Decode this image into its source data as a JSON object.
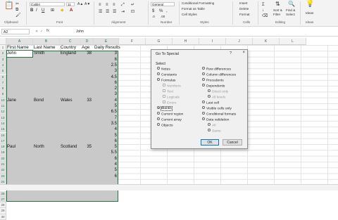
{
  "ribbon": {
    "font_name": "Calibri",
    "font_size": "11",
    "groups": [
      "Clipboard",
      "Font",
      "Alignment",
      "Number",
      "Styles",
      "Cells",
      "Editing",
      "Ideas"
    ],
    "number_format": "General",
    "styles_items": [
      "Conditional Formatting",
      "Format as Table",
      "Cell Styles"
    ],
    "cells_items": [
      "Insert",
      "Delete",
      "Format"
    ],
    "editing_items": [
      "Sort &",
      "Filter",
      "Find &",
      "Select"
    ],
    "ideas_label": "Ideas"
  },
  "formula_bar": {
    "name_box": "A2",
    "fx": "fx",
    "value": "John"
  },
  "columns": [
    "A",
    "B",
    "C",
    "D",
    "E",
    "F",
    "G",
    "H",
    "I",
    "J",
    "K",
    "L"
  ],
  "rows": [
    "1",
    "2",
    "3",
    "4",
    "5",
    "6",
    "7",
    "8",
    "9",
    "10",
    "11",
    "12",
    "13",
    "14",
    "15",
    "16",
    "17",
    "18",
    "19",
    "20",
    "21",
    "22",
    "23",
    "24",
    "25",
    "26",
    "27",
    "28",
    "29",
    "30"
  ],
  "table": {
    "headers": [
      "First Name",
      "Last Name",
      "Country",
      "Age",
      "Daily Results"
    ],
    "cells": [
      {
        "row": 2,
        "col": 0,
        "text": "John"
      },
      {
        "row": 2,
        "col": 1,
        "text": "Smith"
      },
      {
        "row": 2,
        "col": 2,
        "text": "England"
      },
      {
        "row": 2,
        "col": 3,
        "text": "38"
      },
      {
        "row": 2,
        "col": 4,
        "text": "3"
      },
      {
        "row": 3,
        "col": 4,
        "text": "6"
      },
      {
        "row": 4,
        "col": 4,
        "text": "2.5"
      },
      {
        "row": 5,
        "col": 4,
        "text": "3"
      },
      {
        "row": 6,
        "col": 4,
        "text": "4.5"
      },
      {
        "row": 7,
        "col": 4,
        "text": "6"
      },
      {
        "row": 8,
        "col": 4,
        "text": "2"
      },
      {
        "row": 9,
        "col": 4,
        "text": "3"
      },
      {
        "row": 10,
        "col": 0,
        "text": "Jane"
      },
      {
        "row": 10,
        "col": 1,
        "text": "Bond"
      },
      {
        "row": 10,
        "col": 2,
        "text": "Wales"
      },
      {
        "row": 10,
        "col": 3,
        "text": "33"
      },
      {
        "row": 10,
        "col": 4,
        "text": "4"
      },
      {
        "row": 11,
        "col": 4,
        "text": "5"
      },
      {
        "row": 12,
        "col": 4,
        "text": "6.5"
      },
      {
        "row": 13,
        "col": 4,
        "text": "7"
      },
      {
        "row": 14,
        "col": 4,
        "text": "3.5"
      },
      {
        "row": 15,
        "col": 4,
        "text": "4"
      },
      {
        "row": 16,
        "col": 4,
        "text": "5"
      },
      {
        "row": 17,
        "col": 4,
        "text": "6"
      },
      {
        "row": 18,
        "col": 0,
        "text": "Paul"
      },
      {
        "row": 18,
        "col": 1,
        "text": "North"
      },
      {
        "row": 18,
        "col": 2,
        "text": "Scotland"
      },
      {
        "row": 18,
        "col": 3,
        "text": "35"
      },
      {
        "row": 18,
        "col": 4,
        "text": "5"
      },
      {
        "row": 19,
        "col": 4,
        "text": "5.5"
      },
      {
        "row": 20,
        "col": 4,
        "text": "6"
      },
      {
        "row": 21,
        "col": 4,
        "text": "4"
      },
      {
        "row": 22,
        "col": 4,
        "text": "5"
      },
      {
        "row": 23,
        "col": 4,
        "text": "6"
      }
    ]
  },
  "dialog": {
    "title": "Go To Special",
    "help": "?",
    "close": "×",
    "group_label": "Select",
    "left_options": [
      "Notes",
      "Constants",
      "Formulas",
      "Numbers",
      "Text",
      "Logicals",
      "Errors",
      "Blanks",
      "Current region",
      "Current array",
      "Objects"
    ],
    "right_options": [
      "Row differences",
      "Column differences",
      "Precedents",
      "Dependents",
      "Direct only",
      "All levels",
      "Last cell",
      "Visible cells only",
      "Conditional formats",
      "Data validation",
      "All",
      "Same"
    ],
    "selected_option": "Blanks",
    "ok": "OK",
    "cancel": "Cancel"
  }
}
